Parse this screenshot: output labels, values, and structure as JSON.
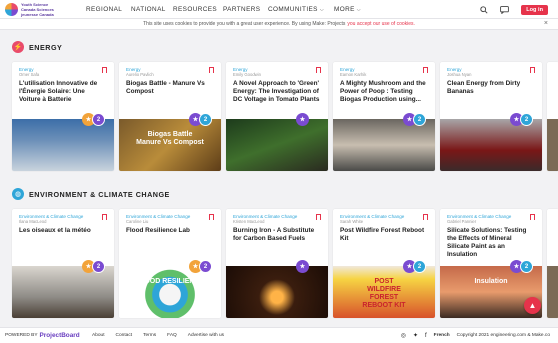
{
  "header": {
    "logo_text": "Youth Science Canada Sciences jeunesse Canada",
    "nav": [
      {
        "label": "REGIONAL",
        "has_chevron": false
      },
      {
        "label": "NATIONAL",
        "has_chevron": false
      },
      {
        "label": "RESOURCES",
        "has_chevron": false
      },
      {
        "label": "PARTNERS",
        "has_chevron": false
      },
      {
        "label": "COMMUNITIES",
        "has_chevron": true
      },
      {
        "label": "MORE",
        "has_chevron": true
      }
    ],
    "login_label": "Log in"
  },
  "cookie_bar": {
    "text": "This site uses cookies to provide you with a great user experience. By using Make: Projects",
    "link": "you accept our use of cookies."
  },
  "sections": [
    {
      "title": "ENERGY",
      "icon_color": "#e94b6a",
      "cards": [
        {
          "tag": "Energy",
          "author": "Omer Safa",
          "title": "L'utilisation Innovative de l'Énergie Solaire: Une Voiture à Batterie",
          "badge_color": "#f2a33a",
          "badge2_color": "#7a4bd1"
        },
        {
          "tag": "Energy",
          "author": "Aurelio Pavlich",
          "title": "Biogas Battle - Manure Vs Compost",
          "badge_color": "#7a4bd1",
          "badge2_color": "#2ea5d8"
        },
        {
          "tag": "Energy",
          "author": "Emily Goodwin",
          "title": "A Novel Approach to 'Green' Energy: The Investigation of DC Voltage in Tomato Plants",
          "badge_color": "#7a4bd1",
          "badge2_color": ""
        },
        {
          "tag": "Energy",
          "author": "Eamon Karhik",
          "title": "A Mighty Mushroom and the Power of Poop : Testing Biogas Production using...",
          "badge_color": "#7a4bd1",
          "badge2_color": "#2ea5d8"
        },
        {
          "tag": "Energy",
          "author": "Joshua Nyan",
          "title": "Clean Energy from Dirty Bananas",
          "badge_color": "#7a4bd1",
          "badge2_color": "#2ea5d8"
        }
      ]
    },
    {
      "title": "ENVIRONMENT & CLIMATE CHANGE",
      "icon_color": "#2ea5d8",
      "cards": [
        {
          "tag": "Environment & Climate Change",
          "author": "Ilana MacLeod",
          "title": "Les oiseaux et la météo",
          "badge_color": "#f2a33a",
          "badge2_color": "#7a4bd1"
        },
        {
          "tag": "Environment & Climate Change",
          "author": "Caroline Liu",
          "title": "Flood Resilience Lab",
          "badge_color": "#f2a33a",
          "badge2_color": "#7a4bd1"
        },
        {
          "tag": "Environment & Climate Change",
          "author": "Kristen MacLeod",
          "title": "Burning Iron - A Substitute for Carbon Based Fuels",
          "badge_color": "#7a4bd1",
          "badge2_color": ""
        },
        {
          "tag": "Environment & Climate Change",
          "author": "Sarah White",
          "title": "Post Wildfire Forest Reboot Kit",
          "badge_color": "#7a4bd1",
          "badge2_color": "#2ea5d8"
        },
        {
          "tag": "Environment & Climate Change",
          "author": "Gabriel Pannier",
          "title": "Silicate Solutions: Testing the Effects of Mineral Silicate Paint as an Insulation",
          "badge_color": "#7a4bd1",
          "badge2_color": "#2ea5d8"
        }
      ]
    }
  ],
  "footer": {
    "powered_by": "POWERED BY",
    "brand": "ProjectBoard",
    "links": [
      "About",
      "Contact",
      "Terms",
      "FAQ",
      "Advertise with us"
    ],
    "language": "French",
    "copyright": "Copyright 2021 engineering.com & Make.co"
  },
  "colors": {
    "accent": "#e6334b",
    "link_blue": "#2ea5d8",
    "purple": "#7a4bd1"
  },
  "icons": [
    "search-icon",
    "chat-icon",
    "close-icon",
    "bookmark-icon",
    "instagram-icon",
    "twitter-icon",
    "facebook-icon",
    "arrow-up-icon"
  ]
}
